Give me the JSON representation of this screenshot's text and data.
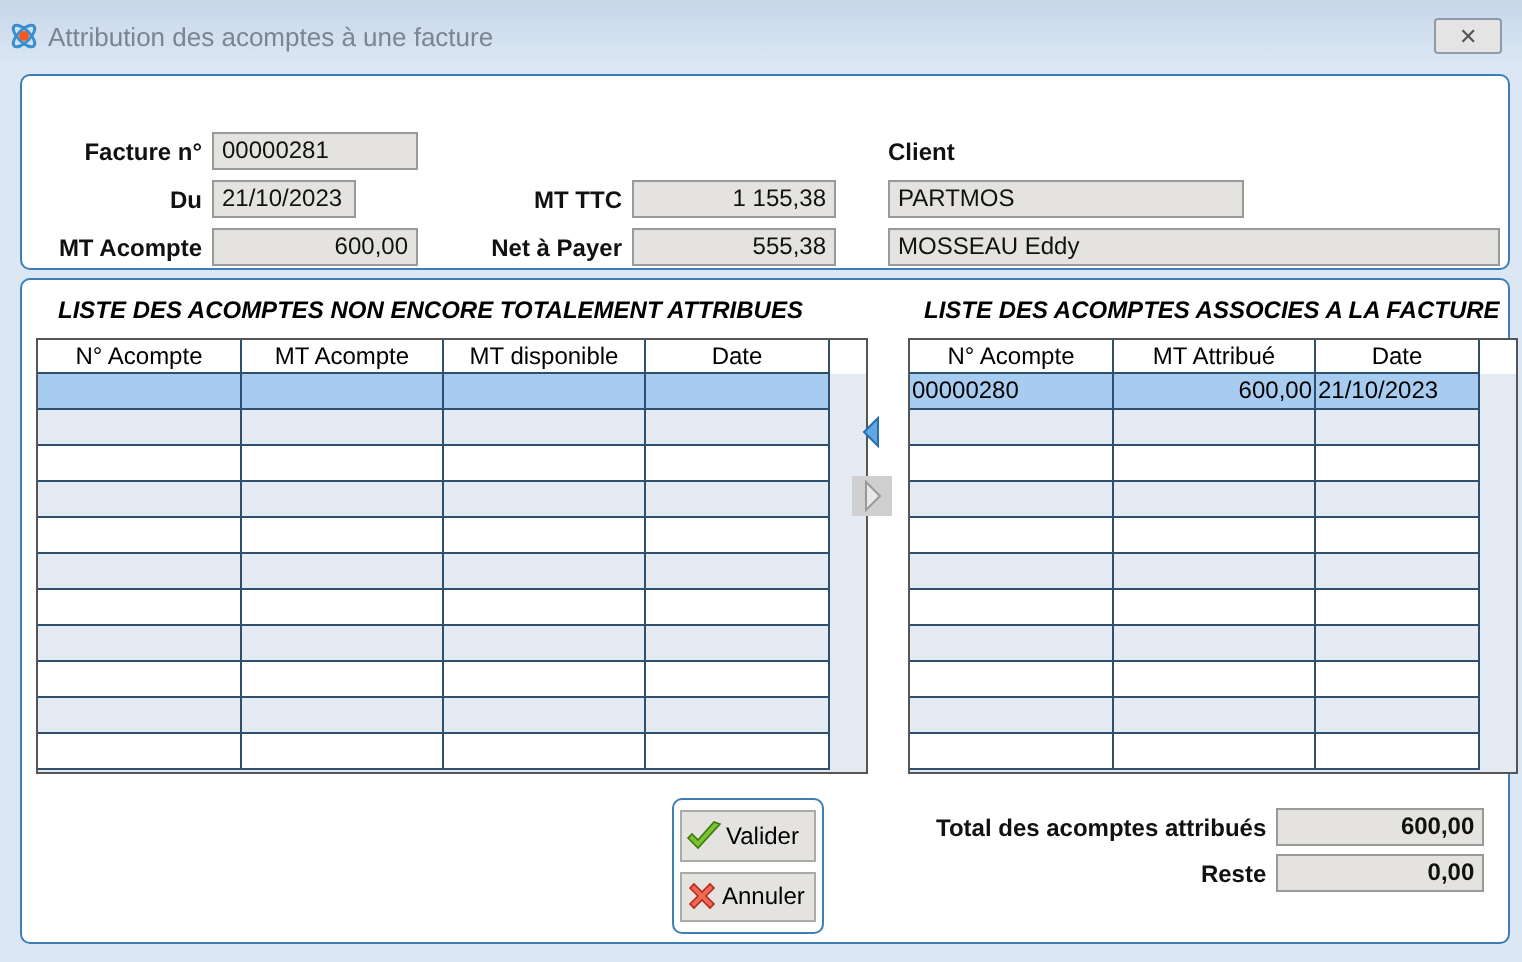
{
  "window": {
    "title": "Attribution des acomptes à une facture",
    "close": "✕"
  },
  "invoice": {
    "number_label": "Facture n°",
    "number": "00000281",
    "date_label": "Du",
    "date": "21/10/2023",
    "deposit_label": "MT Acompte",
    "deposit": "600,00",
    "ttc_label": "MT TTC",
    "ttc": "1 155,38",
    "net_label": "Net à Payer",
    "net": "555,38",
    "client_label": "Client",
    "client_code": "PARTMOS",
    "client_name": "MOSSEAU Eddy"
  },
  "left_list": {
    "title": "LISTE DES ACOMPTES NON ENCORE TOTALEMENT ATTRIBUES",
    "columns": [
      "N° Acompte",
      "MT Acompte",
      "MT disponible",
      "Date"
    ],
    "rows": [
      {
        "selected": true
      },
      {
        "selected": false
      },
      {
        "selected": false
      },
      {
        "selected": false
      },
      {
        "selected": false
      },
      {
        "selected": false
      },
      {
        "selected": false
      },
      {
        "selected": false
      },
      {
        "selected": false
      },
      {
        "selected": false
      },
      {
        "selected": false
      }
    ]
  },
  "right_list": {
    "title": "LISTE DES ACOMPTES ASSOCIES A LA FACTURE",
    "columns": [
      "N° Acompte",
      "MT Attribué",
      "Date"
    ],
    "rows": [
      {
        "selected": true,
        "cells": [
          "00000280",
          "600,00",
          "21/10/2023"
        ]
      },
      {
        "selected": false
      },
      {
        "selected": false
      },
      {
        "selected": false
      },
      {
        "selected": false
      },
      {
        "selected": false
      },
      {
        "selected": false
      },
      {
        "selected": false
      },
      {
        "selected": false
      },
      {
        "selected": false
      },
      {
        "selected": false
      }
    ]
  },
  "buttons": [
    {
      "kind": "ok",
      "label": "Valider"
    },
    {
      "kind": "cancel",
      "label": "Annuler"
    }
  ],
  "totals": [
    {
      "label": "Total des acomptes attribués",
      "value": "600,00"
    },
    {
      "label": "Reste",
      "value": "0,00"
    }
  ]
}
